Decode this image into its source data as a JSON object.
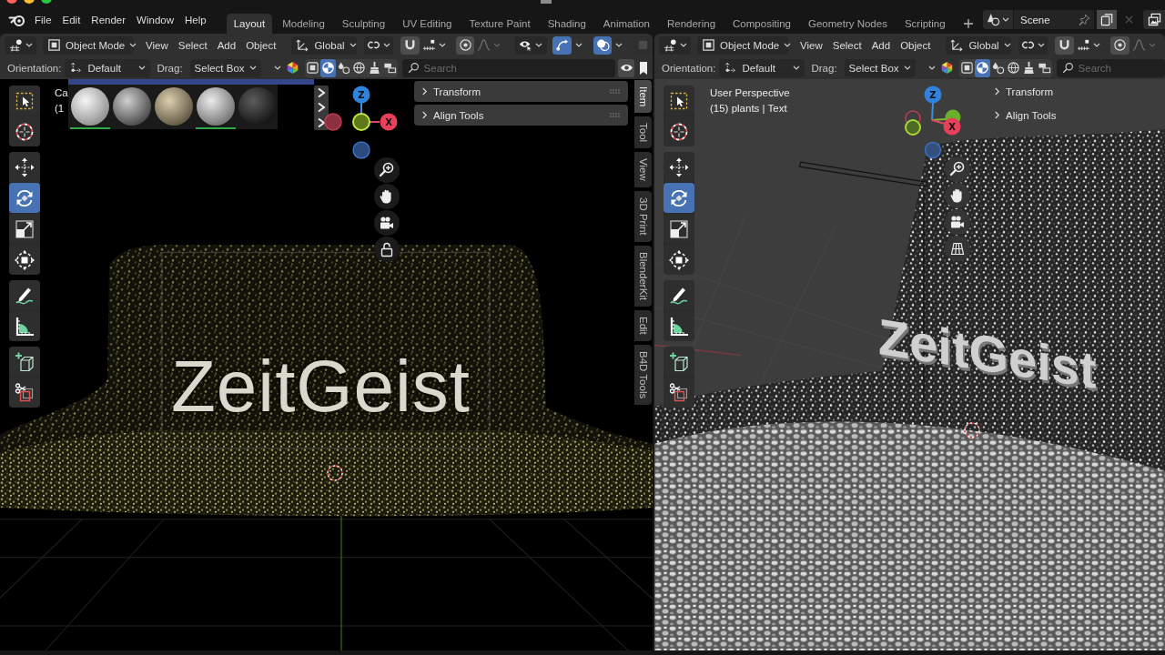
{
  "menu": [
    "File",
    "Edit",
    "Render",
    "Window",
    "Help"
  ],
  "workspaces": [
    {
      "label": "Layout",
      "selected": true
    },
    {
      "label": "Modeling",
      "selected": false
    },
    {
      "label": "Sculpting",
      "selected": false
    },
    {
      "label": "UV Editing",
      "selected": false
    },
    {
      "label": "Texture Paint",
      "selected": false
    },
    {
      "label": "Shading",
      "selected": false
    },
    {
      "label": "Animation",
      "selected": false
    },
    {
      "label": "Rendering",
      "selected": false
    },
    {
      "label": "Compositing",
      "selected": false
    },
    {
      "label": "Geometry Nodes",
      "selected": false
    },
    {
      "label": "Scripting",
      "selected": false
    }
  ],
  "scene": {
    "name": "Scene"
  },
  "viewports": [
    {
      "kind": "rendered",
      "mode": "Object Mode",
      "menus": [
        "View",
        "Select",
        "Add",
        "Object"
      ],
      "transform_orientation": "Global",
      "toggles": [
        {
          "on": false
        },
        {
          "on": false
        },
        {
          "on": true
        },
        {
          "on": true
        },
        {
          "on": false
        }
      ],
      "orientation_label": "Orientation:",
      "orientation": "Default",
      "drag_label": "Drag:",
      "drag": "Select Box",
      "shading": [
        {
          "selected": false
        },
        {
          "selected": true
        },
        {
          "selected": false
        },
        {
          "selected": false
        },
        {
          "selected": false
        },
        {
          "selected": false
        }
      ],
      "search": {
        "placeholder": "Search"
      },
      "toolbar": [
        [
          {
            "selected": false
          },
          {
            "selected": false
          }
        ],
        [
          {
            "selected": false
          },
          {
            "selected": true
          },
          {
            "selected": false
          },
          {
            "selected": false
          }
        ],
        [
          {
            "selected": false
          },
          {
            "selected": false
          }
        ],
        [
          {
            "selected": false
          },
          {
            "selected": false
          }
        ]
      ],
      "info": [
        "Ca",
        "(1"
      ],
      "material_previews": [
        {
          "selected": true
        },
        {
          "selected": false
        },
        {
          "selected": false
        },
        {
          "selected": true
        },
        {
          "selected": false
        }
      ],
      "gizmo": [
        "Z",
        "X"
      ],
      "panels": [
        {
          "title": "Transform",
          "expanded": false
        },
        {
          "title": "Align Tools",
          "expanded": false
        }
      ],
      "sidebar_tabs": [
        {
          "label": "Item",
          "selected": true
        },
        {
          "label": "Tool",
          "selected": false
        },
        {
          "label": "View",
          "selected": false
        },
        {
          "label": "3D Print",
          "selected": false
        },
        {
          "label": "BlenderKit",
          "selected": false
        },
        {
          "label": "Edit",
          "selected": false
        },
        {
          "label": "B4D Tools",
          "selected": false
        }
      ],
      "scene_text": "ZeitGeist"
    },
    {
      "kind": "solid",
      "mode": "Object Mode",
      "menus": [
        "View",
        "Select",
        "Add",
        "Object"
      ],
      "transform_orientation": "Global",
      "toggles": [
        {
          "on": false
        },
        {
          "on": false
        }
      ],
      "orientation_label": "Orientation:",
      "orientation": "Default",
      "drag_label": "Drag:",
      "drag": "Select Box",
      "shading": [
        {
          "selected": false
        },
        {
          "selected": true
        },
        {
          "selected": false
        },
        {
          "selected": false
        },
        {
          "selected": false
        },
        {
          "selected": false
        }
      ],
      "search": {
        "placeholder": "Search"
      },
      "toolbar": [
        [
          {
            "selected": false
          },
          {
            "selected": false
          }
        ],
        [
          {
            "selected": false
          },
          {
            "selected": true
          },
          {
            "selected": false
          },
          {
            "selected": false
          }
        ],
        [
          {
            "selected": false
          },
          {
            "selected": false
          }
        ],
        [
          {
            "selected": false
          },
          {
            "selected": false
          }
        ]
      ],
      "info": [
        "User Perspective",
        "(15) plants | Text"
      ],
      "gizmo": [
        "Z",
        "X"
      ],
      "panels": [
        {
          "title": "Transform",
          "expanded": false
        },
        {
          "title": "Align Tools",
          "expanded": false
        }
      ],
      "scene_text": "ZeitGeist"
    }
  ]
}
